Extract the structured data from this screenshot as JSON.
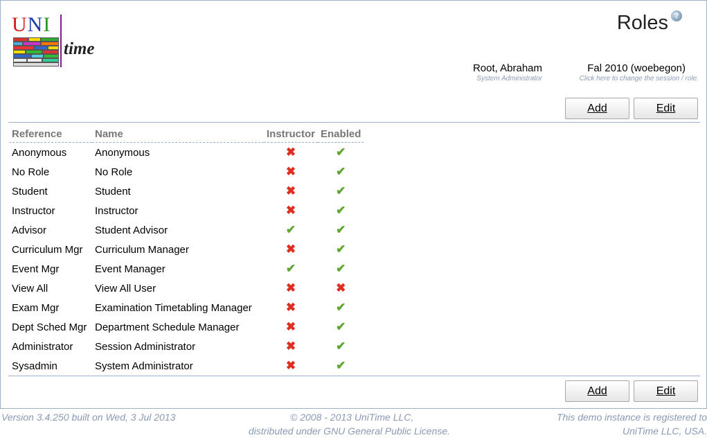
{
  "logo": {
    "uni_u": "U",
    "uni_n": "N",
    "uni_i": "I",
    "time": "time"
  },
  "page": {
    "title": "Roles",
    "help_glyph": "?"
  },
  "user": {
    "name": "Root, Abraham",
    "role": "System Administrator"
  },
  "session": {
    "name": "Fal 2010 (woebegon)",
    "hint": "Click here to change the session / role."
  },
  "buttons": {
    "add": "Add",
    "edit": "Edit"
  },
  "table": {
    "headers": {
      "reference": "Reference",
      "name": "Name",
      "instructor": "Instructor",
      "enabled": "Enabled"
    },
    "rows": [
      {
        "reference": "Anonymous",
        "name": "Anonymous",
        "instructor": false,
        "enabled": true
      },
      {
        "reference": "No Role",
        "name": "No Role",
        "instructor": false,
        "enabled": true
      },
      {
        "reference": "Student",
        "name": "Student",
        "instructor": false,
        "enabled": true
      },
      {
        "reference": "Instructor",
        "name": "Instructor",
        "instructor": false,
        "enabled": true
      },
      {
        "reference": "Advisor",
        "name": "Student Advisor",
        "instructor": true,
        "enabled": true
      },
      {
        "reference": "Curriculum Mgr",
        "name": "Curriculum Manager",
        "instructor": false,
        "enabled": true
      },
      {
        "reference": "Event Mgr",
        "name": "Event Manager",
        "instructor": true,
        "enabled": true
      },
      {
        "reference": "View All",
        "name": "View All User",
        "instructor": false,
        "enabled": false
      },
      {
        "reference": "Exam Mgr",
        "name": "Examination Timetabling Manager",
        "instructor": false,
        "enabled": true
      },
      {
        "reference": "Dept Sched Mgr",
        "name": "Department Schedule Manager",
        "instructor": false,
        "enabled": true
      },
      {
        "reference": "Administrator",
        "name": "Session Administrator",
        "instructor": false,
        "enabled": true
      },
      {
        "reference": "Sysadmin",
        "name": "System Administrator",
        "instructor": false,
        "enabled": true
      }
    ],
    "icons": {
      "true": "check-icon",
      "false": "cross-icon"
    }
  },
  "footer": {
    "version": "Version 3.4.250 built on Wed, 3 Jul 2013",
    "copyright_1": "© 2008 - 2013 UniTime LLC,",
    "copyright_2": "distributed under GNU General Public License.",
    "registered_1": "This demo instance is registered to",
    "registered_2": "UniTime LLC, USA."
  },
  "colors": {
    "border": "#9cb0ce",
    "check": "#5fa532",
    "cross": "#de2e22",
    "muted": "#8a9ab5"
  }
}
